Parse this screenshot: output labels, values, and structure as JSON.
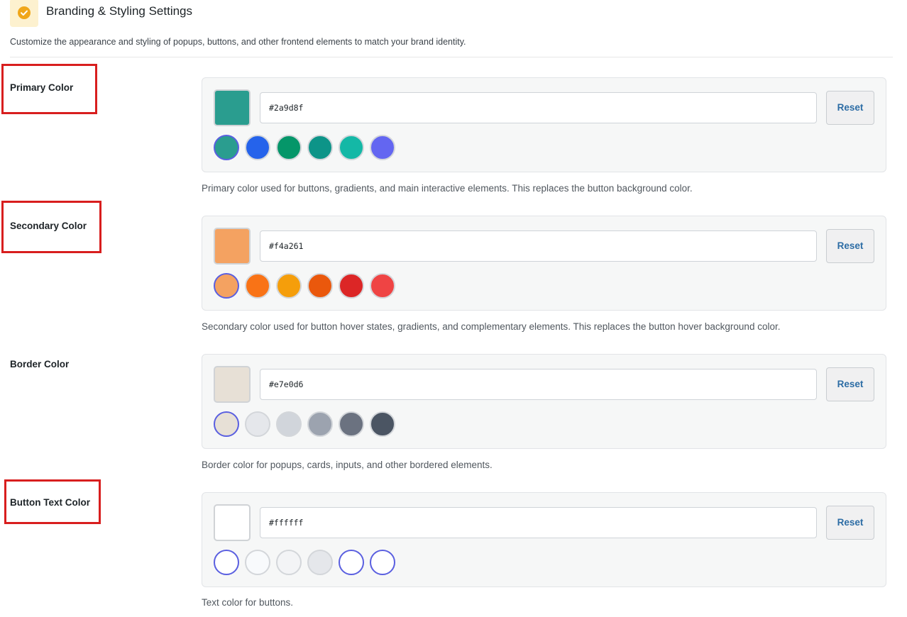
{
  "header": {
    "title": "Branding & Styling Settings",
    "description": "Customize the appearance and styling of popups, buttons, and other frontend elements to match your brand identity.",
    "icon": "check-circle-icon"
  },
  "reset_label": "Reset",
  "sections": [
    {
      "label": "Primary Color",
      "value": "#2a9d8f",
      "swatch_color": "#2a9d8f",
      "help": "Primary color used for buttons, gradients, and main interactive elements. This replaces the button background color.",
      "presets": [
        "#2a9d8f",
        "#2563eb",
        "#059669",
        "#0d9488",
        "#14b8a6",
        "#6366f1"
      ],
      "selected_preset": 0
    },
    {
      "label": "Secondary Color",
      "value": "#f4a261",
      "swatch_color": "#f4a261",
      "help": "Secondary color used for button hover states, gradients, and complementary elements. This replaces the button hover background color.",
      "presets": [
        "#f4a261",
        "#f97316",
        "#f59e0b",
        "#ea580c",
        "#dc2626",
        "#ef4444"
      ],
      "selected_preset": 0
    },
    {
      "label": "Border Color",
      "value": "#e7e0d6",
      "swatch_color": "#e7e0d6",
      "help": "Border color for popups, cards, inputs, and other bordered elements.",
      "presets": [
        "#e7e0d6",
        "#e5e7eb",
        "#d1d5db",
        "#9ca3af",
        "#6b7280",
        "#4b5563"
      ],
      "selected_preset": 0
    },
    {
      "label": "Button Text Color",
      "value": "#ffffff",
      "swatch_color": "#ffffff",
      "help": "Text color for buttons.",
      "presets": [
        "#ffffff",
        "#f8fafc",
        "#f3f4f6",
        "#e5e7eb",
        "#ffffff",
        "#ffffff"
      ],
      "selected_preset": 0
    }
  ]
}
